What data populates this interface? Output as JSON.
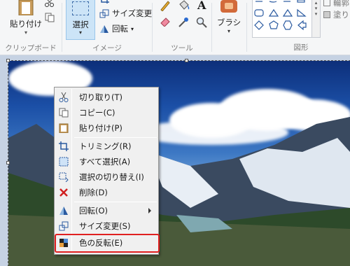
{
  "ribbon": {
    "clipboard": {
      "paste_label": "貼り付け",
      "group_label": "クリップボード"
    },
    "image": {
      "select_label": "選択",
      "resize_label": "サイズ変更",
      "rotate_label": "回転",
      "group_label": "イメージ"
    },
    "tools": {
      "group_label": "ツール",
      "text_icon_glyph": "A"
    },
    "brush": {
      "label": "ブラシ"
    },
    "shapes": {
      "group_label": "図形",
      "outline_label": "輪郭",
      "fill_label": "塗り"
    }
  },
  "context_menu": {
    "items": [
      {
        "label": "切り取り(T)",
        "icon": "scissors-icon"
      },
      {
        "label": "コピー(C)",
        "icon": "copy-icon"
      },
      {
        "label": "貼り付け(P)",
        "icon": "paste-icon"
      },
      {
        "label": "トリミング(R)",
        "icon": "crop-icon"
      },
      {
        "label": "すべて選択(A)",
        "icon": "select-all-icon"
      },
      {
        "label": "選択の切り替え(I)",
        "icon": "invert-selection-icon"
      },
      {
        "label": "削除(D)",
        "icon": "delete-icon"
      },
      {
        "label": "回転(O)",
        "icon": "rotate-icon",
        "submenu": true
      },
      {
        "label": "サイズ変更(S)",
        "icon": "resize-icon"
      },
      {
        "label": "色の反転(E)",
        "icon": "invert-color-icon",
        "highlighted": true
      }
    ]
  },
  "colors": {
    "highlight_border": "#e02020",
    "selection_fill": "#cce4f7"
  }
}
